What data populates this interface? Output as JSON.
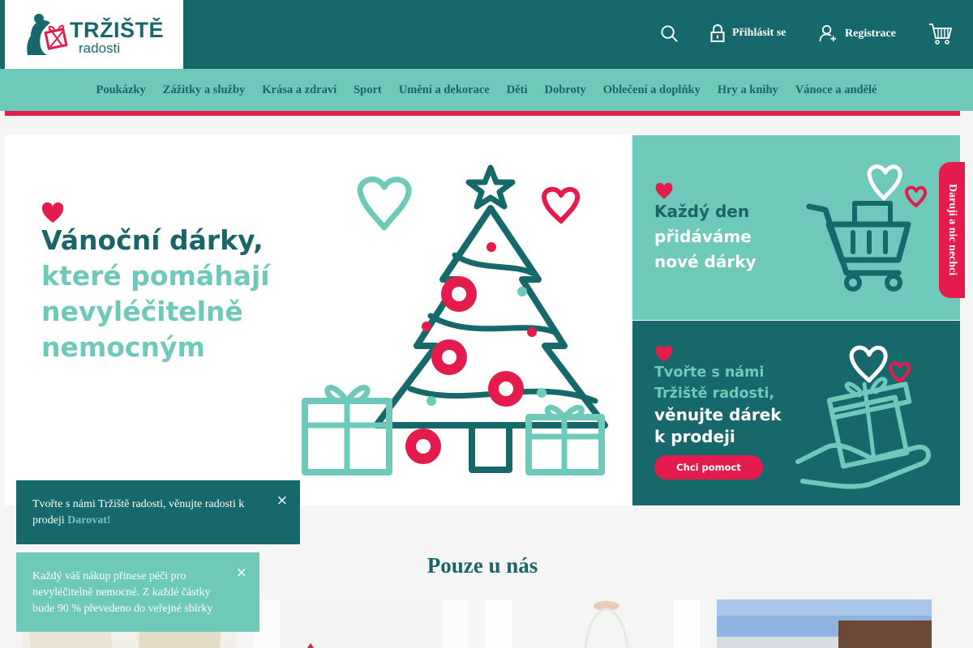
{
  "header": {
    "logo": {
      "name": "TRŽIŠTĚ",
      "sub": "radosti"
    },
    "login_label": "Přihlásit se",
    "register_label": "Registrace"
  },
  "nav": {
    "items": [
      {
        "label": "Poukázky"
      },
      {
        "label": "Zážitky a služby"
      },
      {
        "label": "Krása a zdraví"
      },
      {
        "label": "Sport"
      },
      {
        "label": "Umění a dekorace"
      },
      {
        "label": "Děti"
      },
      {
        "label": "Dobroty"
      },
      {
        "label": "Oblečení a doplňky"
      },
      {
        "label": "Hry a knihy"
      },
      {
        "label": "Vánoce a andělé"
      }
    ]
  },
  "hero": {
    "line1": "Vánoční dárky,",
    "line2": "které pomáhají",
    "line3": "nevyléčitelně",
    "line4": "nemocným"
  },
  "banner_top": {
    "line1": "Každý den",
    "line2": "přidáváme",
    "line3": "nové dárky"
  },
  "banner_bottom": {
    "line1": "Tvořte s námi",
    "line2": "Tržiště radosti,",
    "line3": "věnujte dárek",
    "line4": "k prodeji",
    "button": "Chci pomoct"
  },
  "side_tab": {
    "label": "Daruji a nic nechci"
  },
  "section": {
    "title": "Pouze u nás"
  },
  "toasts": {
    "donate": {
      "text": "Tvořte s námi Tržiště radosti, věnujte radosti k prodeji",
      "link": "Darovat!",
      "close": "×"
    },
    "info": {
      "text": "Každý váš nákup přinese péči pro nevyléčitelně nemocné. Z každé částky bude 90 % převedeno do veřejné sbírky",
      "close": "×"
    }
  },
  "colors": {
    "teal_dark": "#17686a",
    "teal_light": "#6fc9bb",
    "red": "#e41c4d"
  },
  "icons": [
    "search-icon",
    "lock-icon",
    "user-add-icon",
    "cart-icon"
  ]
}
